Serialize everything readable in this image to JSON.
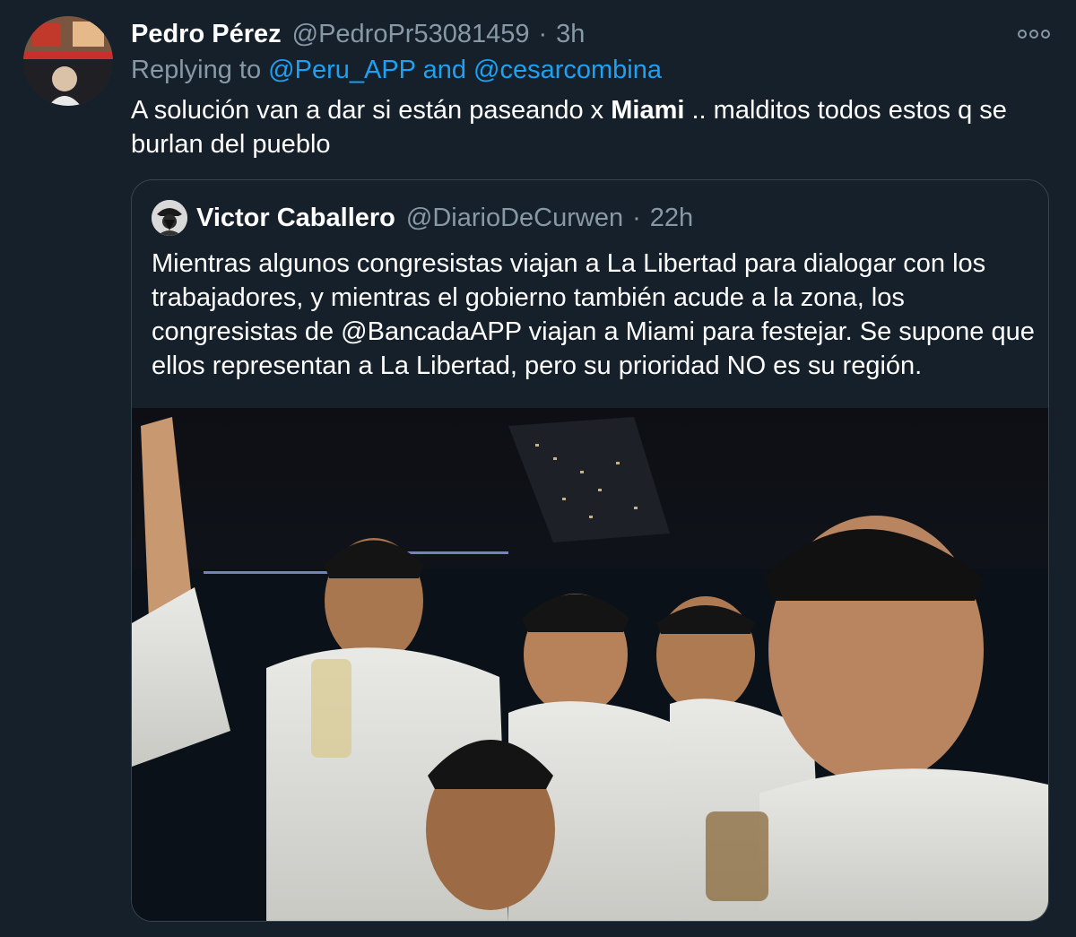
{
  "tweet": {
    "display_name": "Pedro Pérez",
    "handle": "@PedroPr53081459",
    "separator": "·",
    "time": "3h",
    "replying_prefix": "Replying to",
    "reply_to_1": "@Peru_APP",
    "reply_and": "and",
    "reply_to_2": "@cesarcombina",
    "text_part1": "A solución van a dar si están paseando x ",
    "text_bold": "Miami",
    "text_part2": " .. malditos todos estos q se burlan del pueblo",
    "avatar_icon": "profile-photo-icon",
    "more_icon": "more-options-icon"
  },
  "quoted": {
    "display_name": "Victor Caballero",
    "handle": "@DiarioDeCurwen",
    "separator": "·",
    "time": "22h",
    "text": "Mientras algunos congresistas viajan a La Libertad para dialogar con los trabajadores, y mientras el gobierno también acude a la zona, los congresistas de @BancadaAPP viajan a Miami para festejar. Se supone que ellos representan a La Libertad, pero su prioridad NO es su región.",
    "photo_icon": "group-selfie-photo"
  },
  "colors": {
    "background": "#15202b",
    "text": "#ffffff",
    "muted": "#8899a6",
    "link": "#1da1f2",
    "border": "#38444d"
  }
}
